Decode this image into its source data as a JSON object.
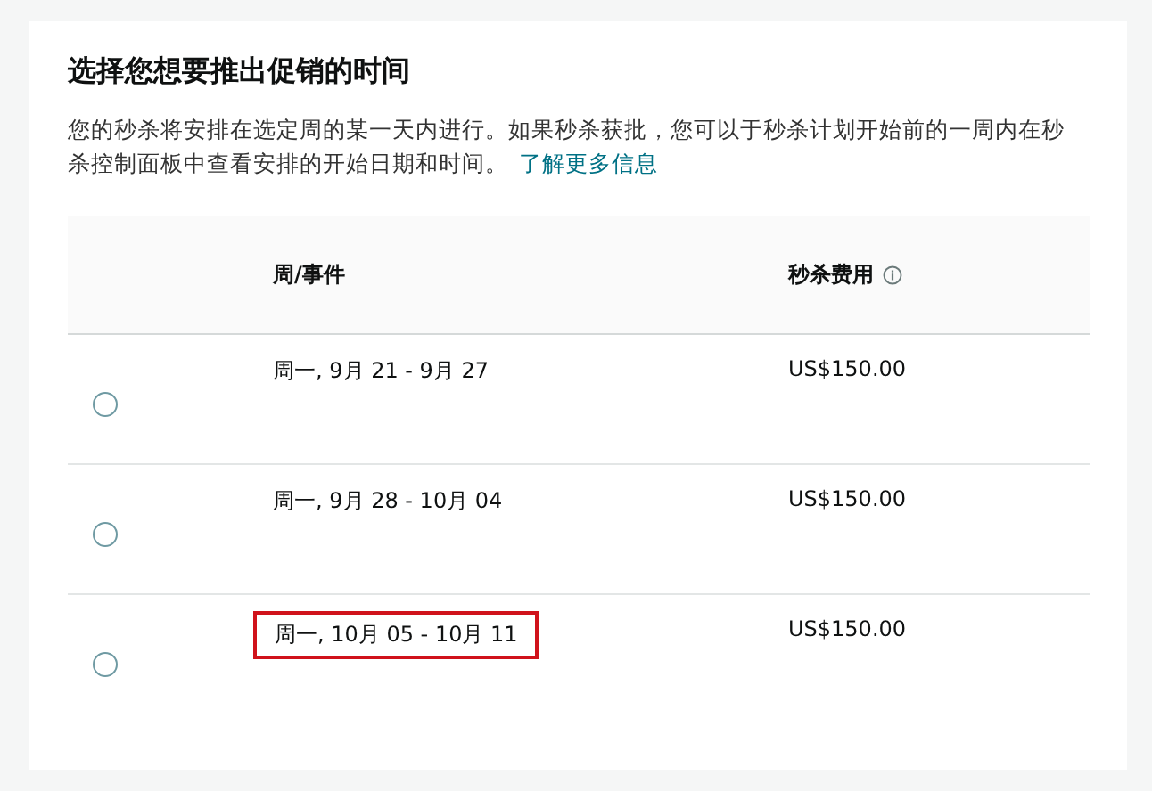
{
  "heading": "选择您想要推出促销的时间",
  "description": "您的秒杀将安排在选定周的某一天内进行。如果秒杀获批，您可以于秒杀计划开始前的一周内在秒杀控制面板中查看安排的开始日期和时间。",
  "learn_more_link": "了解更多信息",
  "table": {
    "columns": [
      "周/事件",
      "秒杀费用"
    ],
    "rows": [
      {
        "week": "周一, 9月 21 - 9月 27",
        "fee": "US$150.00",
        "selected": false,
        "highlighted": false
      },
      {
        "week": "周一, 9月 28 - 10月 04",
        "fee": "US$150.00",
        "selected": false,
        "highlighted": false
      },
      {
        "week": "周一, 10月 05 - 10月 11",
        "fee": "US$150.00",
        "selected": false,
        "highlighted": true
      }
    ]
  }
}
